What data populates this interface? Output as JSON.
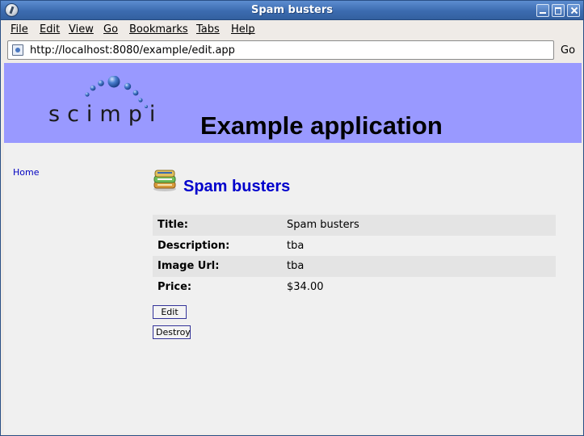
{
  "window": {
    "title": "Spam busters"
  },
  "menubar": {
    "items": [
      "File",
      "Edit",
      "View",
      "Go",
      "Bookmarks",
      "Tabs",
      "Help"
    ]
  },
  "navbar": {
    "url": "http://localhost:8080/example/edit.app",
    "go_label": "Go"
  },
  "header": {
    "logo_text": "scimpi",
    "heading": "Example application",
    "background_color": "#9999ff"
  },
  "sidebar": {
    "home_link": "Home"
  },
  "record": {
    "title": "Spam busters",
    "icon": "stacked-books-icon",
    "fields": [
      {
        "label": "Title:",
        "value": "Spam busters"
      },
      {
        "label": "Description:",
        "value": "tba"
      },
      {
        "label": "Image Url:",
        "value": "tba"
      },
      {
        "label": "Price:",
        "value": "$34.00"
      }
    ]
  },
  "actions": {
    "edit_label": "Edit",
    "destroy_label": "Destroy"
  }
}
